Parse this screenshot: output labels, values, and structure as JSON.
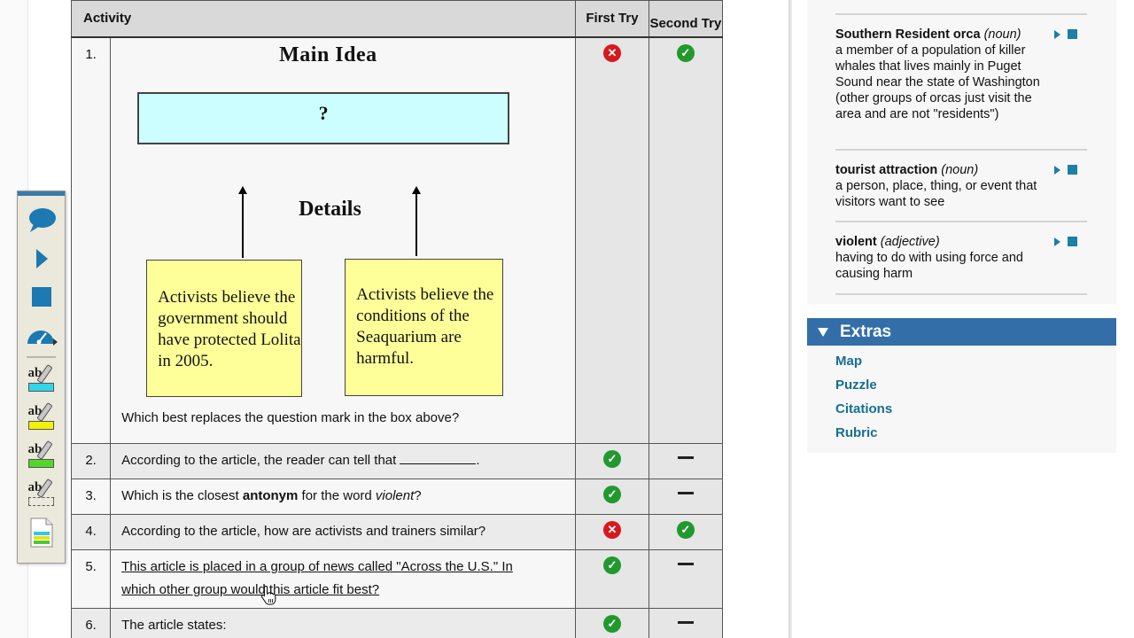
{
  "activity_table": {
    "headers": {
      "activity": "Activity",
      "first_try": "First Try",
      "second_try": "Second Try"
    },
    "rows": [
      {
        "number": "1.",
        "diagram": {
          "title": "Main Idea",
          "main_box": "?",
          "details_label": "Details",
          "detail_boxes": [
            "Activists believe the government should have protected Lolita in 2005.",
            "Activists believe the conditions of the Seaquarium are harmful."
          ]
        },
        "question": "Which best replaces the question mark in the box above?",
        "first_try": "wrong",
        "second_try": "correct"
      },
      {
        "number": "2.",
        "question": "According to the article, the reader can tell that",
        "question_suffix": ".",
        "first_try": "correct",
        "second_try": "none"
      },
      {
        "number": "3.",
        "question_pre": "Which is the closest ",
        "question_bold": "antonym",
        "question_mid": " for the word ",
        "question_italic": "violent",
        "question_post": "?",
        "first_try": "correct",
        "second_try": "none"
      },
      {
        "number": "4.",
        "question": "According to the article, how are activists and trainers similar?",
        "first_try": "wrong",
        "second_try": "correct"
      },
      {
        "number": "5.",
        "question": "This article is placed in a group of news called \"Across the U.S.\" In which other group would this article fit best?",
        "first_try": "correct",
        "second_try": "none"
      },
      {
        "number": "6.",
        "question": "The article states:",
        "first_try": "correct",
        "second_try": "none"
      }
    ]
  },
  "status_icons": {
    "correct": "check-circle-icon",
    "wrong": "x-circle-icon",
    "none": "dash-icon"
  },
  "toolbar": {
    "buttons": [
      {
        "name": "speech-bubble-icon",
        "label": "Read aloud"
      },
      {
        "name": "play-icon",
        "label": "Play"
      },
      {
        "name": "stop-icon",
        "label": "Stop"
      },
      {
        "name": "speed-gauge-icon",
        "label": "Speed"
      },
      {
        "name": "highlighter-blue-icon",
        "label": "Highlight blue",
        "color": "#33d6e8"
      },
      {
        "name": "highlighter-yellow-icon",
        "label": "Highlight yellow",
        "color": "#f2f20a"
      },
      {
        "name": "highlighter-green-icon",
        "label": "Highlight green",
        "color": "#55d62b"
      },
      {
        "name": "eraser-highlight-icon",
        "label": "Clear highlight"
      },
      {
        "name": "highlight-summary-icon",
        "label": "Highlight summary"
      }
    ]
  },
  "glossary": {
    "entries": [
      {
        "word": "Southern Resident orca",
        "pos": "(noun)",
        "definition": "a member of a population of killer whales that lives mainly in Puget Sound near the state of Washington (other groups of orcas just visit the area and are not \"residents\")"
      },
      {
        "word": "tourist attraction",
        "pos": "(noun)",
        "definition": "a person, place, thing, or event that visitors want to see"
      },
      {
        "word": "violent",
        "pos": "(adjective)",
        "definition": "having to do with using force and causing harm"
      }
    ]
  },
  "extras": {
    "title": "Extras",
    "links": [
      "Map",
      "Puzzle",
      "Citations",
      "Rubric"
    ]
  },
  "colors": {
    "accent_blue": "#336ea8",
    "link_teal": "#16708f",
    "correct_green": "#22992e",
    "wrong_red": "#d7191f",
    "main_idea_box": "#ccfeff",
    "detail_box": "#ffff99"
  }
}
